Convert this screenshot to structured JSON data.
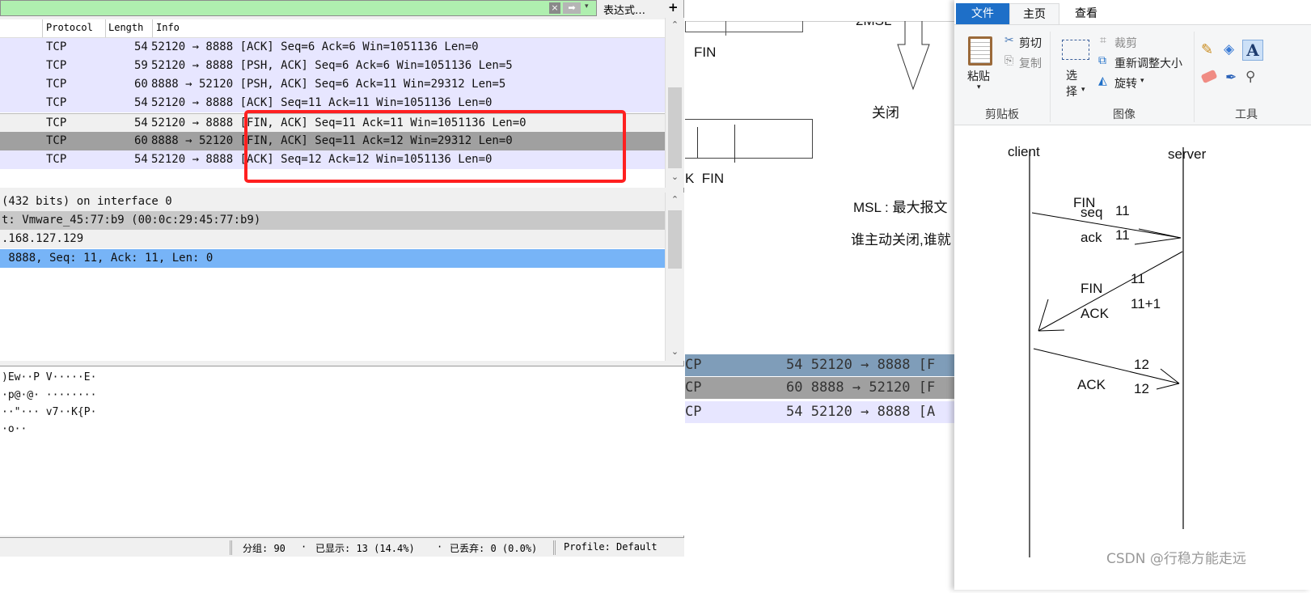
{
  "wireshark": {
    "filter_bar": {
      "expression_button": "表达式…",
      "add_button": "+"
    },
    "columns": [
      "Protocol",
      "Length",
      "Info"
    ],
    "packets": [
      {
        "protocol": "TCP",
        "length": "54",
        "info": "52120 → 8888 [ACK] Seq=6 Ack=6 Win=1051136 Len=0"
      },
      {
        "protocol": "TCP",
        "length": "59",
        "info": "52120 → 8888 [PSH, ACK] Seq=6 Ack=6 Win=1051136 Len=5"
      },
      {
        "protocol": "TCP",
        "length": "60",
        "info": "8888 → 52120 [PSH, ACK] Seq=6 Ack=11 Win=29312 Len=5"
      },
      {
        "protocol": "TCP",
        "length": "54",
        "info": "52120 → 8888 [ACK] Seq=11 Ack=11 Win=1051136 Len=0"
      },
      {
        "protocol": "TCP",
        "length": "54",
        "info": "52120 → 8888 [FIN, ACK] Seq=11 Ack=11 Win=1051136 Len=0"
      },
      {
        "protocol": "TCP",
        "length": "60",
        "info": "8888 → 52120 [FIN, ACK] Seq=11 Ack=12 Win=29312 Len=0"
      },
      {
        "protocol": "TCP",
        "length": "54",
        "info": "52120 → 8888 [ACK] Seq=12 Ack=12 Win=1051136 Len=0"
      }
    ],
    "details": [
      "(432 bits) on interface 0",
      "t: Vmware_45:77:b9 (00:0c:29:45:77:b9)",
      ".168.127.129",
      " 8888, Seq: 11, Ack: 11, Len: 0"
    ],
    "bytes": [
      ")Ew··P V·····E·",
      "·p@·@· ········",
      "··\"··· v7··K{P·",
      "·o··"
    ],
    "status": {
      "packets": "分组: 90",
      "displayed": "已显示: 13 (14.4%)",
      "dropped": "已丢弃: 0 (0.0%)",
      "profile": "Profile: Default"
    },
    "highlight_color": "#ff2020"
  },
  "background_doc": {
    "texts": {
      "fin1": "FIN",
      "msl2": "2MSL",
      "close": "关闭",
      "kfin": "K  FIN",
      "msl": "MSL : 最大报文",
      "who": "谁主动关闭,谁就"
    },
    "rows": [
      {
        "proto": "CP",
        "info": "54 52120 → 8888 [F"
      },
      {
        "proto": "CP",
        "info": "60 8888 → 52120 [F"
      },
      {
        "proto": "CP",
        "info": "54 52120 → 8888 [A"
      }
    ]
  },
  "paint": {
    "tabs": [
      "文件",
      "主页",
      "查看"
    ],
    "clipboard": {
      "paste": "粘贴",
      "cut": "剪切",
      "copy": "复制",
      "group": "剪贴板"
    },
    "image": {
      "select": "选择",
      "crop": "裁剪",
      "resize": "重新调整大小",
      "rotate": "旋转",
      "group": "图像"
    },
    "tools": {
      "group": "工具"
    },
    "diagram": {
      "client": "client",
      "server": "server",
      "fin1": "FIN",
      "seq": "seq",
      "seq_val": "11",
      "ack": "ack",
      "ack_val": "11",
      "v11": "11",
      "fin2": "FIN",
      "ack2": "ACK",
      "v11p1": "11+1",
      "v12a": "12",
      "ack3": "ACK",
      "v12b": "12"
    },
    "watermark": "CSDN @行稳方能走远"
  }
}
